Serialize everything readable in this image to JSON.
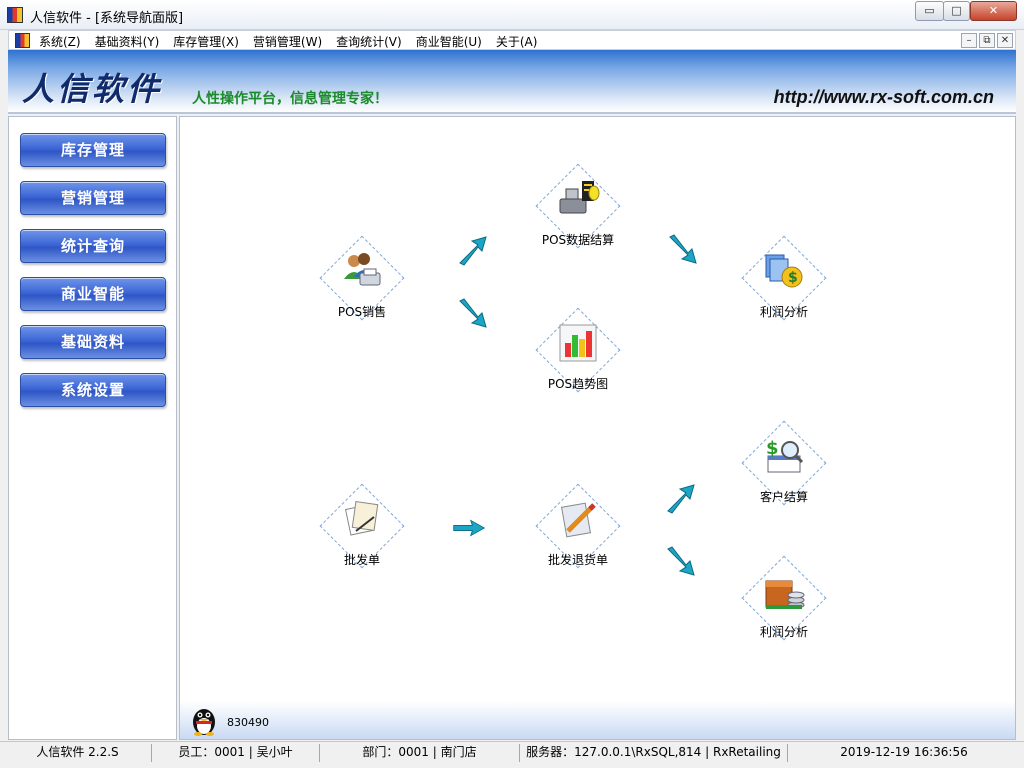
{
  "window": {
    "title": "人信软件 - [系统导航面版]",
    "controls": {
      "minimize": "▭",
      "maximize": "□",
      "close": "✕"
    }
  },
  "menubar": {
    "items": [
      "系统(Z)",
      "基础资料(Y)",
      "库存管理(X)",
      "营销管理(W)",
      "查询统计(V)",
      "商业智能(U)",
      "关于(A)"
    ],
    "mdi_controls": {
      "minimize": "–",
      "restore": "⧉",
      "close": "✕"
    }
  },
  "banner": {
    "logo": "人信软件",
    "slogan": "人性操作平台，信息管理专家！",
    "url": "http://www.rx-soft.com.cn"
  },
  "sidebar": {
    "items": [
      "库存管理",
      "营销管理",
      "统计查询",
      "商业智能",
      "基础资料",
      "系统设置"
    ]
  },
  "flow": {
    "nodes": {
      "pos_sales": "POS销售",
      "pos_settlement": "POS数据结算",
      "pos_trend": "POS趋势图",
      "profit_analysis_1": "利润分析",
      "wholesale": "批发单",
      "wholesale_return": "批发退货单",
      "customer_settlement": "客户结算",
      "profit_analysis_2": "利润分析"
    },
    "icons": {
      "pos_sales": "users-printer-icon",
      "pos_settlement": "pos-terminal-icon",
      "pos_trend": "bar-chart-icon",
      "profit_analysis_1": "documents-dollar-icon",
      "wholesale": "papers-pen-icon",
      "wholesale_return": "notepad-pencil-icon",
      "customer_settlement": "dollar-magnifier-icon",
      "profit_analysis_2": "money-box-icon"
    },
    "accent_color": "#1aa6c4"
  },
  "footer": {
    "qq_number": "830490"
  },
  "statusbar": {
    "version": "人信软件 2.2.S",
    "employee": "员工：0001 | 吴小叶",
    "department": "部门：0001 | 南门店",
    "server": "服务器：127.0.0.1\\RxSQL,814 | RxRetailing",
    "datetime": "2019-12-19 16:36:56"
  }
}
